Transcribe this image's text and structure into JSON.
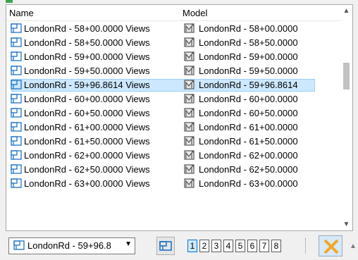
{
  "list": {
    "columns": {
      "name": "Name",
      "model": "Model"
    },
    "rows": [
      {
        "name": "LondonRd - 58+00.0000 Views",
        "model": "LondonRd - 58+00.0000",
        "selected": false
      },
      {
        "name": "LondonRd - 58+50.0000 Views",
        "model": "LondonRd - 58+50.0000",
        "selected": false
      },
      {
        "name": "LondonRd - 59+00.0000 Views",
        "model": "LondonRd - 59+00.0000",
        "selected": false
      },
      {
        "name": "LondonRd - 59+50.0000 Views",
        "model": "LondonRd - 59+50.0000",
        "selected": false
      },
      {
        "name": "LondonRd - 59+96.8614 Views",
        "model": "LondonRd - 59+96.8614",
        "selected": true
      },
      {
        "name": "LondonRd - 60+00.0000 Views",
        "model": "LondonRd - 60+00.0000",
        "selected": false
      },
      {
        "name": "LondonRd - 60+50.0000 Views",
        "model": "LondonRd - 60+50.0000",
        "selected": false
      },
      {
        "name": "LondonRd - 61+00.0000 Views",
        "model": "LondonRd - 61+00.0000",
        "selected": false
      },
      {
        "name": "LondonRd - 61+50.0000 Views",
        "model": "LondonRd - 61+50.0000",
        "selected": false
      },
      {
        "name": "LondonRd - 62+00.0000 Views",
        "model": "LondonRd - 62+00.0000",
        "selected": false
      },
      {
        "name": "LondonRd - 62+50.0000 Views",
        "model": "LondonRd - 62+50.0000",
        "selected": false
      },
      {
        "name": "LondonRd - 63+00.0000 Views",
        "model": "LondonRd - 63+00.0000",
        "selected": false
      }
    ],
    "row_icon": "saved-view-icon",
    "model_icon": "model-icon"
  },
  "toolbar": {
    "view_combo_value": "LondonRd - 59+96.8",
    "view_combo_icon": "saved-view-icon",
    "views_button_icon": "views-icon",
    "pages": [
      "1",
      "2",
      "3",
      "4",
      "5",
      "6",
      "7",
      "8"
    ],
    "active_page": "1",
    "close_icon": "close-x-icon"
  },
  "colors": {
    "icon_blue": "#1e73c8",
    "selection": "#cce8ff",
    "close_orange": "#f5a623"
  }
}
